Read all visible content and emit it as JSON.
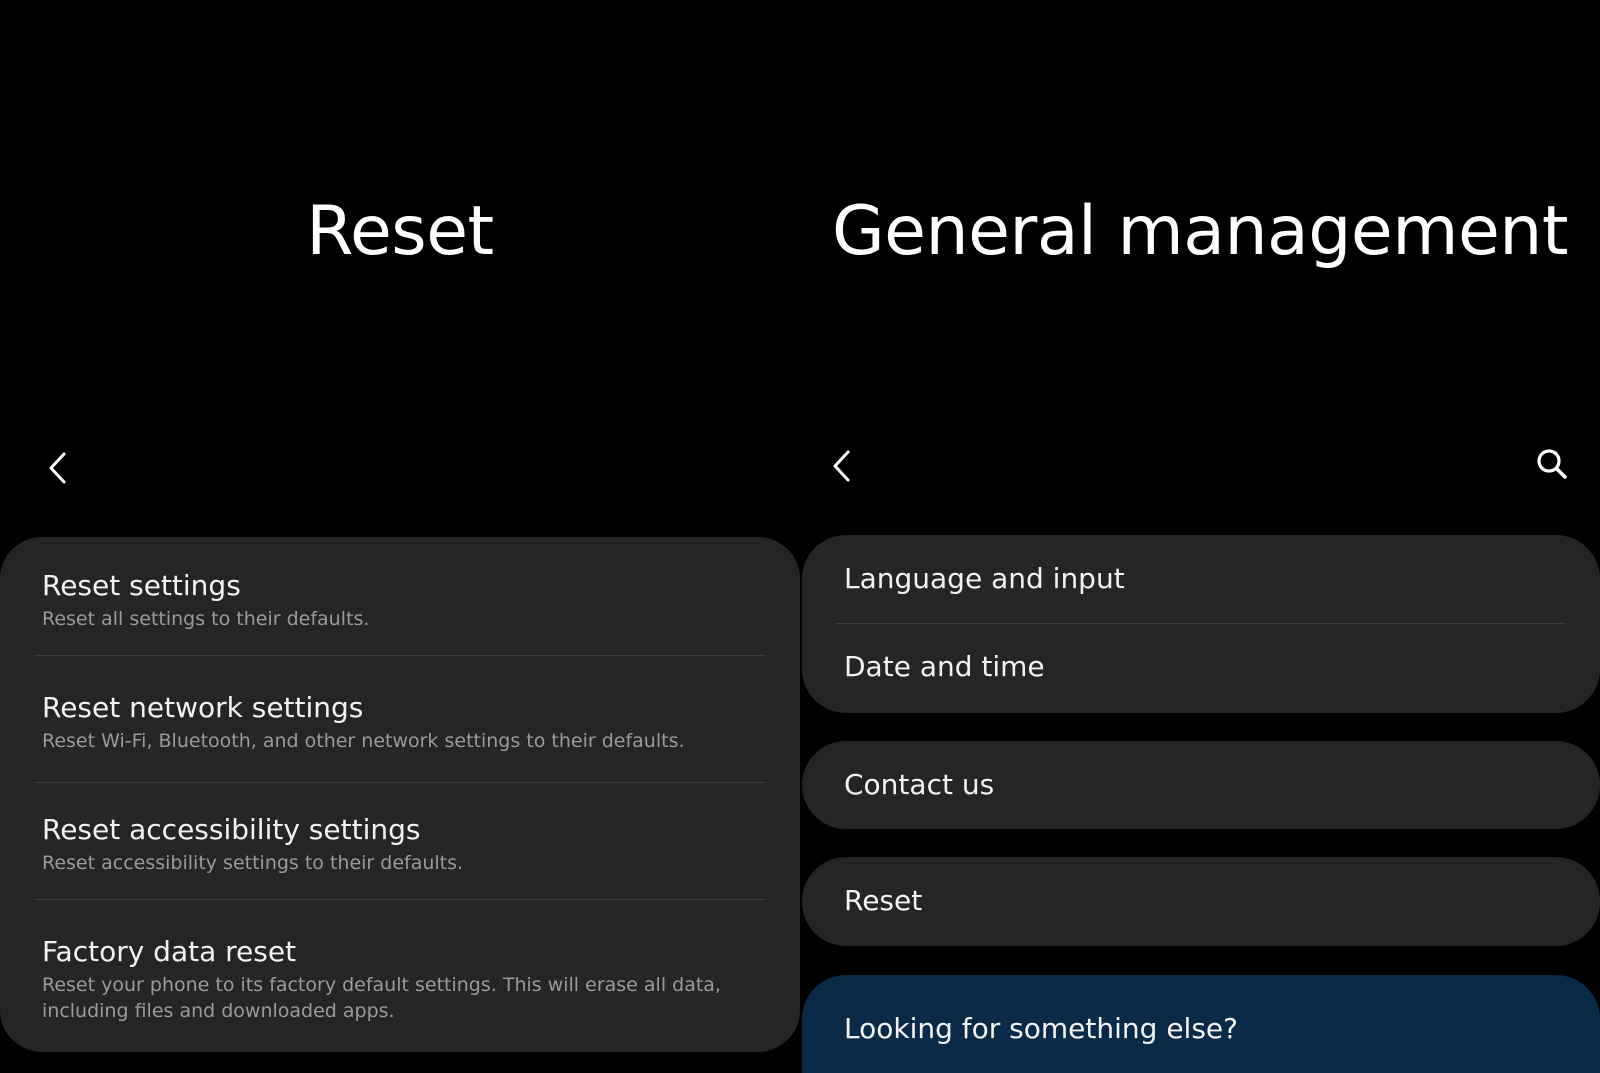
{
  "left_screen": {
    "title": "Reset",
    "items": [
      {
        "title": "Reset settings",
        "description": "Reset all settings to their defaults."
      },
      {
        "title": "Reset network settings",
        "description": "Reset Wi-Fi, Bluetooth, and other network settings to their defaults."
      },
      {
        "title": "Reset accessibility settings",
        "description": "Reset accessibility settings to their defaults."
      },
      {
        "title": "Factory data reset",
        "description": "Reset your phone to its factory default settings. This will erase all data, including files and downloaded apps."
      }
    ]
  },
  "right_screen": {
    "title": "General management",
    "group1": [
      "Language and input",
      "Date and time"
    ],
    "contact": "Contact us",
    "reset": "Reset",
    "looking": "Looking for something else?"
  },
  "icons": {
    "back": "chevron-left-icon",
    "search": "search-icon"
  },
  "colors": {
    "background": "#000000",
    "card": "#252525",
    "highlight_card": "#0b2a47",
    "primary_text": "#f2f2f2",
    "secondary_text": "#9a9a9a"
  }
}
